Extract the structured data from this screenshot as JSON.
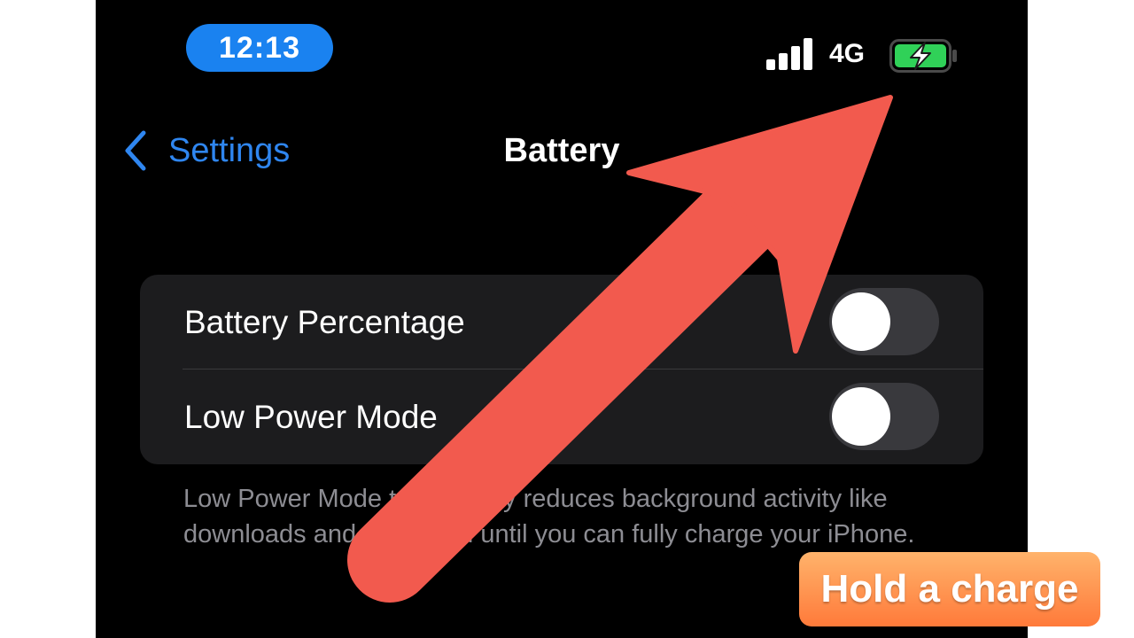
{
  "status_bar": {
    "time": "12:13",
    "network": "4G",
    "signal_bars": 4,
    "battery_charging": true,
    "accent_color": "#1a82f0",
    "battery_color": "#30d158"
  },
  "nav": {
    "back_label": "Settings",
    "title": "Battery"
  },
  "settings": {
    "rows": [
      {
        "label": "Battery Percentage",
        "enabled": false
      },
      {
        "label": "Low Power Mode",
        "enabled": false
      }
    ],
    "footer_note": "Low Power Mode temporarily reduces background activity like downloads and mail fetch until you can fully charge your iPhone."
  },
  "overlay": {
    "caption": "Hold a charge",
    "arrow_color": "#f25a4e"
  }
}
